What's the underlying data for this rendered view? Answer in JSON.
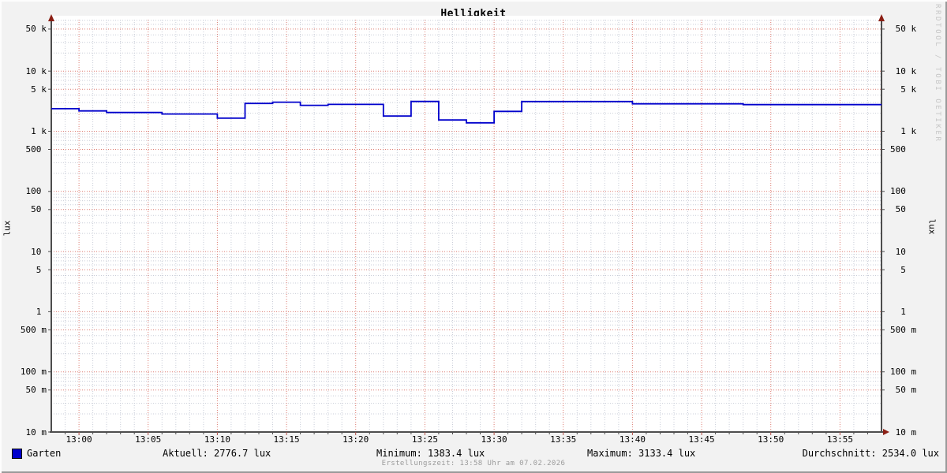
{
  "title": "Helligkeit",
  "watermark": "RRDTOOL / TOBI OETIKER",
  "footer": {
    "created_text": "Erstellungszeit: 13:58 Uhr am 07.02.2026"
  },
  "legend": {
    "series_label": "Garten",
    "aktuell_text": "Aktuell: 2776.7 lux",
    "minimum_text": "Minimum: 1383.4 lux",
    "maximum_text": "Maximum: 3133.4 lux",
    "durchschnitt_text": "Durchschnitt: 2534.0 lux"
  },
  "colors": {
    "series_line": "#0000cc",
    "grid_major": "#dd7c72",
    "grid_minor": "#c9cdd8",
    "axis": "#4d4d4d",
    "arrow": "#8b1f14",
    "plot_background": "#ffffff",
    "canvas_background": "#f2f2f2"
  },
  "chart_data": {
    "type": "line",
    "title": "Helligkeit",
    "ylabel": "lux",
    "ylabel_right": "lux",
    "y_scale": "log",
    "ylim": [
      0.01,
      71600
    ],
    "grid": true,
    "legend_position": "bottom",
    "x_start": "12:58",
    "x_end": "13:58",
    "x_ticks": [
      "13:00",
      "13:05",
      "13:10",
      "13:15",
      "13:20",
      "13:25",
      "13:30",
      "13:35",
      "13:40",
      "13:45",
      "13:50",
      "13:55"
    ],
    "y_ticks": [
      {
        "value": 50000,
        "num": "50",
        "suffix": "k"
      },
      {
        "value": 10000,
        "num": "10",
        "suffix": "k"
      },
      {
        "value": 5000,
        "num": "5",
        "suffix": "k"
      },
      {
        "value": 1000,
        "num": "1",
        "suffix": "k"
      },
      {
        "value": 500,
        "num": "500",
        "suffix": ""
      },
      {
        "value": 100,
        "num": "100",
        "suffix": ""
      },
      {
        "value": 50,
        "num": "50",
        "suffix": ""
      },
      {
        "value": 10,
        "num": "10",
        "suffix": ""
      },
      {
        "value": 5,
        "num": "5",
        "suffix": ""
      },
      {
        "value": 1,
        "num": "1",
        "suffix": ""
      },
      {
        "value": 0.5,
        "num": "500",
        "suffix": "m"
      },
      {
        "value": 0.1,
        "num": "100",
        "suffix": "m"
      },
      {
        "value": 0.05,
        "num": "50",
        "suffix": "m"
      },
      {
        "value": 0.01,
        "num": "10",
        "suffix": "m"
      }
    ],
    "series": [
      {
        "name": "Garten",
        "color": "#0000cc",
        "line_style": "step-after",
        "points": [
          {
            "time": "12:58",
            "lux": 2370
          },
          {
            "time": "13:00",
            "lux": 2180
          },
          {
            "time": "13:02",
            "lux": 2050
          },
          {
            "time": "13:06",
            "lux": 1940
          },
          {
            "time": "13:10",
            "lux": 1650
          },
          {
            "time": "13:12",
            "lux": 2900
          },
          {
            "time": "13:14",
            "lux": 3050
          },
          {
            "time": "13:16",
            "lux": 2700
          },
          {
            "time": "13:18",
            "lux": 2800
          },
          {
            "time": "13:22",
            "lux": 1790
          },
          {
            "time": "13:24",
            "lux": 3133.4
          },
          {
            "time": "13:26",
            "lux": 1540
          },
          {
            "time": "13:28",
            "lux": 1383.4
          },
          {
            "time": "13:30",
            "lux": 2140
          },
          {
            "time": "13:32",
            "lux": 3120
          },
          {
            "time": "13:40",
            "lux": 2860
          },
          {
            "time": "13:48",
            "lux": 2776.7
          }
        ]
      }
    ],
    "stats": {
      "aktuell": 2776.7,
      "minimum": 1383.4,
      "maximum": 3133.4,
      "durchschnitt": 2534.0,
      "unit": "lux"
    }
  }
}
